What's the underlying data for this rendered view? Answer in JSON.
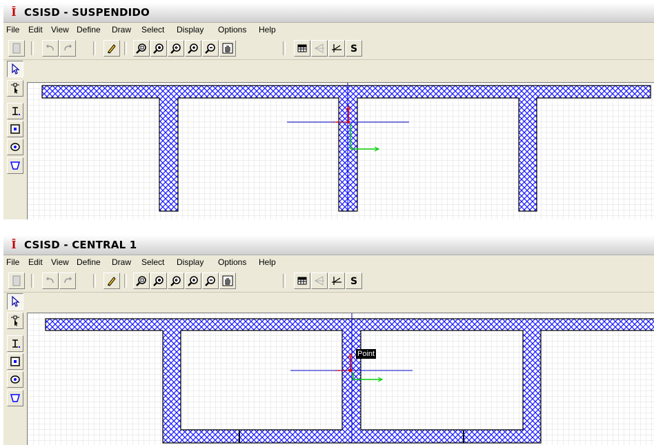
{
  "windows": [
    {
      "title": "CSISD - SUSPENDIDO"
    },
    {
      "title": "CSISD - CENTRAL 1",
      "tooltip": "Point"
    }
  ],
  "menu": [
    "File",
    "Edit",
    "View",
    "Define",
    "Draw",
    "Select",
    "Display",
    "Options",
    "Help"
  ],
  "toolbar_icons": [
    "new-page-icon",
    "undo-icon",
    "redo-icon",
    "pencil-icon",
    "zoom-window-icon",
    "zoom-rubberband-icon",
    "zoom-previous-icon",
    "zoom-in-icon",
    "zoom-out-icon",
    "pan-hand-icon",
    "table-icon",
    "mirror-icon",
    "axes-icon",
    "section-s-icon"
  ],
  "side_tools": [
    "pointer-icon",
    "reshape-pointer-icon",
    "i-section-icon",
    "rectangle-icon",
    "circle-icon",
    "polygon-icon"
  ],
  "colors": {
    "hatch": "#1a1aff",
    "axis_blue": "#0000cc",
    "axis_red": "#e00000",
    "axis_green": "#00cc00",
    "grid": "#dcdcdc"
  }
}
